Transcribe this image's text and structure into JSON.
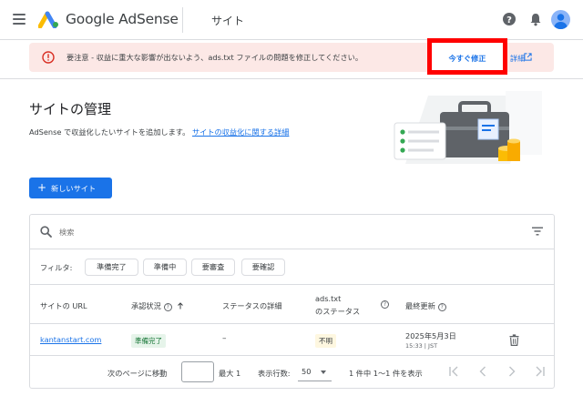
{
  "header": {
    "brand": "Google AdSense",
    "section_title": "サイト"
  },
  "alert": {
    "message": "要注意 - 収益に重大な影響が出ないよう、ads.txt ファイルの問題を修正してください。",
    "fix_label": "今すぐ修正",
    "detail_label": "詳細"
  },
  "page": {
    "title": "サイトの管理",
    "description": "AdSense で収益化したいサイトを追加します。",
    "description_link": "サイトの収益化に関する詳細",
    "new_site_label": "新しいサイト"
  },
  "table": {
    "search_placeholder": "検索",
    "filter_label": "フィルタ:",
    "filters": [
      "準備完了",
      "準備中",
      "要審査",
      "要確認"
    ],
    "columns": {
      "url": "サイトの URL",
      "approval": "承認状況",
      "status_detail": "ステータスの詳細",
      "ads_line1": "ads.txt",
      "ads_line2": "のステータス",
      "updated": "最終更新"
    },
    "rows": [
      {
        "url": "kantanstart.com",
        "approval": "準備完了",
        "status_detail": "–",
        "ads_status": "不明",
        "updated_date": "2025年5月3日",
        "updated_time": "15:33 | JST"
      }
    ]
  },
  "pager": {
    "go_to_page": "次のページに移動",
    "max": "最大 1",
    "rows_label": "表示行数:",
    "rows_value": "50",
    "range": "1 件中 1～1 件を表示"
  },
  "colors": {
    "accent": "#1a73e8",
    "alert_bg": "#fce8e6",
    "alert_icon": "#d93025",
    "highlight_box": "#ff0000"
  }
}
